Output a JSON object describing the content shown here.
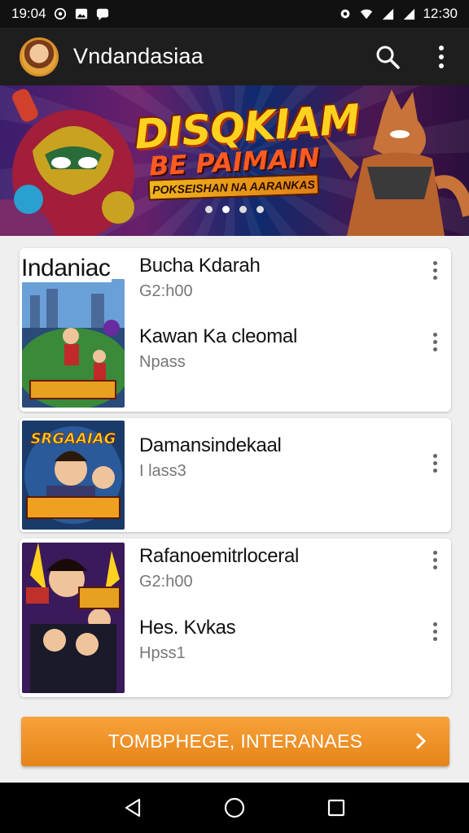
{
  "status_bar": {
    "time": "19:04",
    "clock_right": "12:30",
    "left_icons": [
      "whatsapp-icon",
      "photo-icon",
      "message-icon"
    ],
    "right_icons": [
      "settings-icon",
      "wifi-icon",
      "signal-icon",
      "battery-icon"
    ]
  },
  "app_bar": {
    "title": "Vndandasiaa",
    "actions": [
      "search-icon",
      "more-vert-icon"
    ]
  },
  "banner": {
    "title": "DISQKIAM",
    "subtitle": "BE PAIMAIN",
    "tagline": "POKSEISHAN NA AARANKAS",
    "page_count": 4,
    "active_index": 1
  },
  "list": {
    "section_label": "Indaniac",
    "cards": [
      {
        "entries": [
          {
            "name": "Bucha Kdarah",
            "meta": "G2:h00"
          },
          {
            "name": "Kawan Ka cleomal",
            "meta": "Npass"
          }
        ]
      },
      {
        "thumb_caption": "SRGAAIAG",
        "entries": [
          {
            "name": "Damansindekaal",
            "meta": "I lass3"
          }
        ]
      },
      {
        "entries": [
          {
            "name": "Rafanoemitrloceral",
            "meta": "G2:h00"
          },
          {
            "name": "Hes. Kvkas",
            "meta": "Hpss1"
          }
        ]
      }
    ]
  },
  "cta": {
    "label": "TOMBPHEGE, INTERANAES"
  },
  "nav": [
    "back-icon",
    "home-icon",
    "recents-icon"
  ],
  "colors": {
    "accent": "#ee9225",
    "appbar": "#1e1e1e",
    "status": "#111111"
  }
}
